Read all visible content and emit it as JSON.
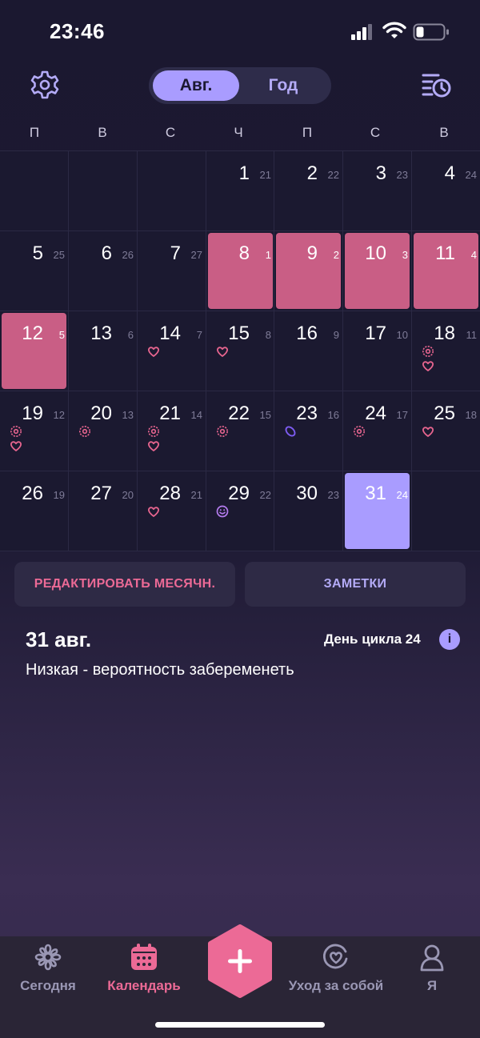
{
  "status_bar": {
    "time": "23:46"
  },
  "header": {
    "segment_month": "Авг.",
    "segment_year": "Год"
  },
  "weekdays": [
    "П",
    "В",
    "С",
    "Ч",
    "П",
    "С",
    "В"
  ],
  "calendar": {
    "weeks": [
      [
        null,
        null,
        null,
        {
          "day": "1",
          "cycle": "21"
        },
        {
          "day": "2",
          "cycle": "22"
        },
        {
          "day": "3",
          "cycle": "23"
        },
        {
          "day": "4",
          "cycle": "24"
        }
      ],
      [
        {
          "day": "5",
          "cycle": "25"
        },
        {
          "day": "6",
          "cycle": "26"
        },
        {
          "day": "7",
          "cycle": "27"
        },
        {
          "day": "8",
          "cycle": "1",
          "period": true
        },
        {
          "day": "9",
          "cycle": "2",
          "period": true
        },
        {
          "day": "10",
          "cycle": "3",
          "period": true
        },
        {
          "day": "11",
          "cycle": "4",
          "period": true
        }
      ],
      [
        {
          "day": "12",
          "cycle": "5",
          "period": true
        },
        {
          "day": "13",
          "cycle": "6"
        },
        {
          "day": "14",
          "cycle": "7",
          "icons": [
            "heart"
          ]
        },
        {
          "day": "15",
          "cycle": "8",
          "icons": [
            "heart"
          ]
        },
        {
          "day": "16",
          "cycle": "9"
        },
        {
          "day": "17",
          "cycle": "10"
        },
        {
          "day": "18",
          "cycle": "11",
          "icons": [
            "flower",
            "heart"
          ]
        }
      ],
      [
        {
          "day": "19",
          "cycle": "12",
          "icons": [
            "flower",
            "heart"
          ]
        },
        {
          "day": "20",
          "cycle": "13",
          "icons": [
            "flower"
          ]
        },
        {
          "day": "21",
          "cycle": "14",
          "icons": [
            "flower",
            "heart"
          ]
        },
        {
          "day": "22",
          "cycle": "15",
          "icons": [
            "flower"
          ]
        },
        {
          "day": "23",
          "cycle": "16",
          "icons": [
            "pill"
          ]
        },
        {
          "day": "24",
          "cycle": "17",
          "icons": [
            "flower"
          ]
        },
        {
          "day": "25",
          "cycle": "18",
          "icons": [
            "heart"
          ]
        }
      ],
      [
        {
          "day": "26",
          "cycle": "19"
        },
        {
          "day": "27",
          "cycle": "20"
        },
        {
          "day": "28",
          "cycle": "21",
          "icons": [
            "heart"
          ]
        },
        {
          "day": "29",
          "cycle": "22",
          "icons": [
            "smile"
          ]
        },
        {
          "day": "30",
          "cycle": "23"
        },
        {
          "day": "31",
          "cycle": "24",
          "today": true
        },
        null
      ]
    ]
  },
  "actions": {
    "edit_period": "РЕДАКТИРОВАТЬ МЕСЯЧН.",
    "notes": "ЗАМЕТКИ"
  },
  "day_info": {
    "date": "31 авг.",
    "cycle_day": "День цикла 24",
    "info_icon": "i",
    "chance": "Низкая - вероятность забеременеть"
  },
  "tabs": {
    "today": "Сегодня",
    "calendar": "Календарь",
    "selfcare": "Уход за собой",
    "me": "Я"
  },
  "colors": {
    "accent": "#a99cff",
    "period": "#c95e85",
    "pink": "#ec6a96",
    "background": "#1b1830"
  }
}
